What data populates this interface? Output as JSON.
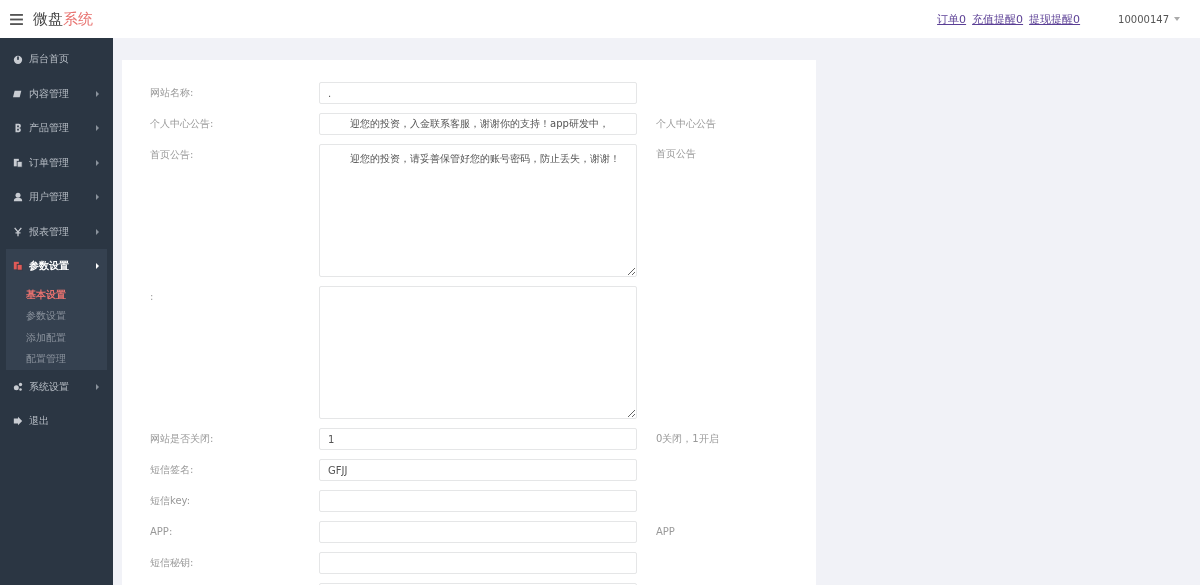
{
  "header": {
    "brand_main": "微盘",
    "brand_accent": "系统",
    "links": [
      "订单0",
      "充值提醒0",
      "提现提醒0"
    ],
    "user": "10000147"
  },
  "sidebar": {
    "items": [
      {
        "label": "后台首页",
        "has_arrow": false,
        "expanded": false
      },
      {
        "label": "内容管理",
        "has_arrow": true,
        "expanded": false
      },
      {
        "label": "产品管理",
        "has_arrow": true,
        "expanded": false
      },
      {
        "label": "订单管理",
        "has_arrow": true,
        "expanded": false
      },
      {
        "label": "用户管理",
        "has_arrow": true,
        "expanded": false
      },
      {
        "label": "报表管理",
        "has_arrow": true,
        "expanded": false
      },
      {
        "label": "参数设置",
        "has_arrow": true,
        "expanded": true,
        "children": [
          {
            "label": "基本设置",
            "selected": true
          },
          {
            "label": "参数设置",
            "selected": false
          },
          {
            "label": "添加配置",
            "selected": false
          },
          {
            "label": "配置管理",
            "selected": false
          }
        ]
      },
      {
        "label": "系统设置",
        "has_arrow": true,
        "expanded": false
      },
      {
        "label": "退出",
        "has_arrow": false,
        "expanded": false
      }
    ]
  },
  "form": {
    "fields": [
      {
        "kind": "input",
        "label": "网站名称:",
        "value": "."
      },
      {
        "kind": "input",
        "label": "个人中心公告:",
        "value": "迎您的投资，入金联系客服，谢谢你的支持！app研发中，",
        "hint": "个人中心公告",
        "gap": true
      },
      {
        "kind": "textarea",
        "label": "首页公告:",
        "value": "迎您的投资，请妥善保管好您的账号密码，防止丢失，谢谢！",
        "hint": "首页公告",
        "gap": true
      },
      {
        "kind": "textarea",
        "label": ":"
      },
      {
        "kind": "input",
        "label": "网站是否关闭:",
        "value": "1",
        "hint": "0关闭，1开启"
      },
      {
        "kind": "input",
        "label": "短信签名:",
        "value": "GFJJ"
      },
      {
        "kind": "input",
        "label": "短信key:"
      },
      {
        "kind": "input",
        "label": "APP:",
        "hint": "APP"
      },
      {
        "kind": "input",
        "label": "短信秘钥:"
      },
      {
        "kind": "input"
      }
    ]
  }
}
